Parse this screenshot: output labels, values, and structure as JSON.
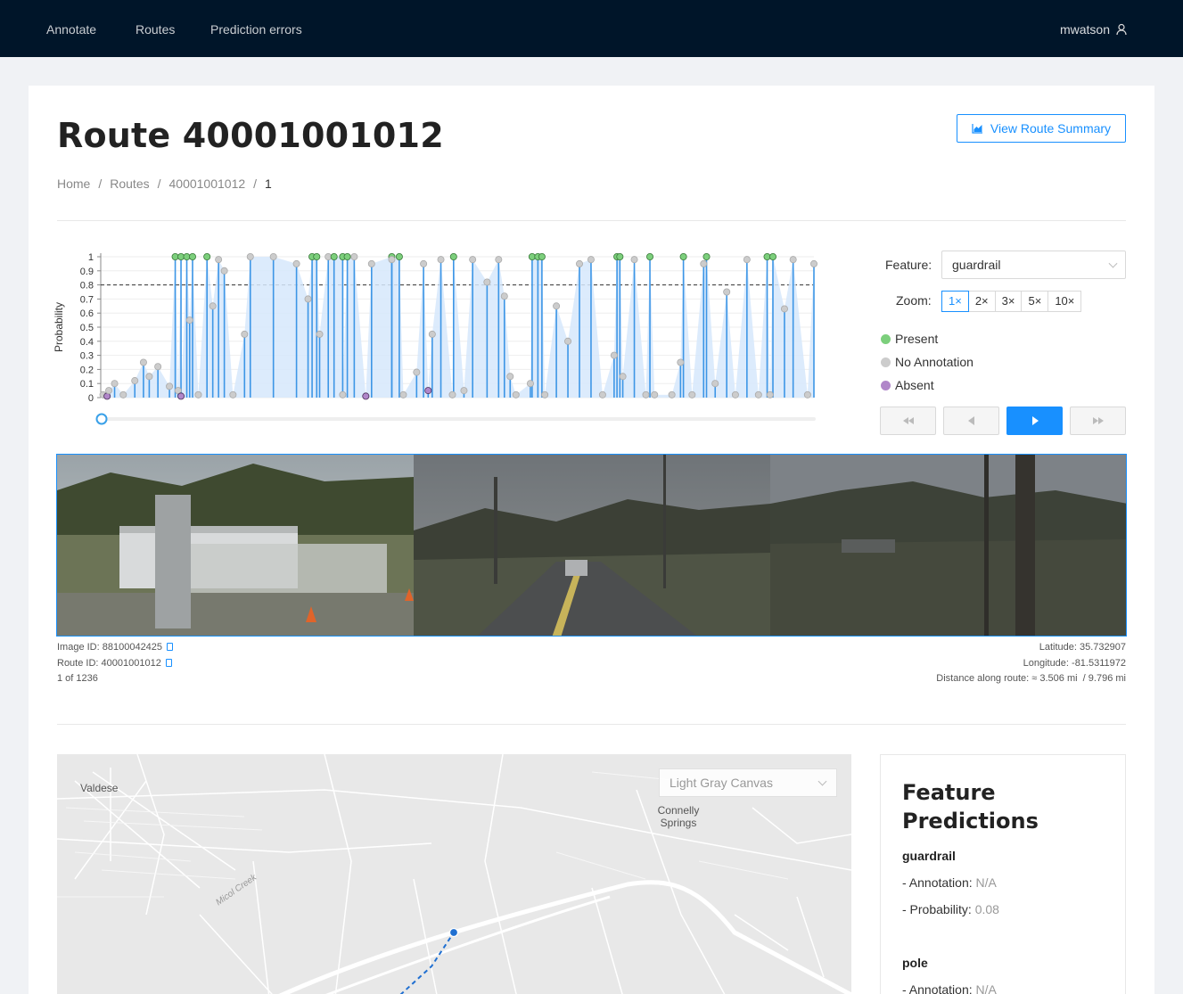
{
  "nav": {
    "items": [
      "Annotate",
      "Routes",
      "Prediction errors"
    ],
    "user": "mwatson"
  },
  "page": {
    "title": "Route 40001001012",
    "summary_button": "View Route Summary",
    "breadcrumb": [
      "Home",
      "Routes",
      "40001001012",
      "1"
    ]
  },
  "chart_data": {
    "type": "scatter",
    "ylabel": "Probability",
    "ylim": [
      0,
      1
    ],
    "yticks": [
      "1",
      "0.9",
      "0.8",
      "0.7",
      "0.6",
      "0.5",
      "0.4",
      "0.3",
      "0.2",
      "0.1",
      "0"
    ],
    "threshold": 0.8,
    "x_range": [
      1,
      1236
    ],
    "series": [
      {
        "name": "Present",
        "color": "#7ccf7c",
        "points": [
          [
            130,
            1
          ],
          [
            140,
            1
          ],
          [
            150,
            1
          ],
          [
            160,
            1
          ],
          [
            185,
            1
          ],
          [
            367,
            1
          ],
          [
            375,
            1
          ],
          [
            405,
            1
          ],
          [
            420,
            1
          ],
          [
            428,
            1
          ],
          [
            505,
            1
          ],
          [
            518,
            1
          ],
          [
            612,
            1
          ],
          [
            748,
            1
          ],
          [
            758,
            1
          ],
          [
            765,
            1
          ],
          [
            895,
            1
          ],
          [
            900,
            1
          ],
          [
            952,
            1
          ],
          [
            1010,
            1
          ],
          [
            1050,
            1
          ],
          [
            1155,
            1
          ],
          [
            1165,
            1
          ]
        ]
      },
      {
        "name": "No Annotation",
        "color": "#cccccc",
        "points": [
          [
            5,
            0.02
          ],
          [
            15,
            0.05
          ],
          [
            25,
            0.1
          ],
          [
            40,
            0.02
          ],
          [
            60,
            0.12
          ],
          [
            75,
            0.25
          ],
          [
            85,
            0.15
          ],
          [
            100,
            0.22
          ],
          [
            120,
            0.08
          ],
          [
            135,
            0.05
          ],
          [
            155,
            0.55
          ],
          [
            170,
            0.02
          ],
          [
            195,
            0.65
          ],
          [
            205,
            0.98
          ],
          [
            215,
            0.9
          ],
          [
            230,
            0.02
          ],
          [
            250,
            0.45
          ],
          [
            260,
            1
          ],
          [
            300,
            1
          ],
          [
            340,
            0.95
          ],
          [
            360,
            0.7
          ],
          [
            380,
            0.45
          ],
          [
            395,
            1
          ],
          [
            420,
            0.02
          ],
          [
            440,
            1
          ],
          [
            470,
            0.95
          ],
          [
            505,
            0.98
          ],
          [
            525,
            0.02
          ],
          [
            548,
            0.18
          ],
          [
            560,
            0.95
          ],
          [
            575,
            0.45
          ],
          [
            590,
            0.98
          ],
          [
            610,
            0.02
          ],
          [
            630,
            0.05
          ],
          [
            645,
            0.98
          ],
          [
            670,
            0.82
          ],
          [
            690,
            0.98
          ],
          [
            700,
            0.72
          ],
          [
            710,
            0.15
          ],
          [
            720,
            0.02
          ],
          [
            745,
            0.1
          ],
          [
            770,
            0.02
          ],
          [
            790,
            0.65
          ],
          [
            810,
            0.4
          ],
          [
            830,
            0.95
          ],
          [
            850,
            0.98
          ],
          [
            870,
            0.02
          ],
          [
            890,
            0.3
          ],
          [
            905,
            0.15
          ],
          [
            925,
            0.98
          ],
          [
            945,
            0.02
          ],
          [
            960,
            0.02
          ],
          [
            990,
            0.02
          ],
          [
            1005,
            0.25
          ],
          [
            1025,
            0.02
          ],
          [
            1045,
            0.95
          ],
          [
            1065,
            0.1
          ],
          [
            1085,
            0.75
          ],
          [
            1100,
            0.02
          ],
          [
            1120,
            0.98
          ],
          [
            1140,
            0.02
          ],
          [
            1160,
            0.02
          ],
          [
            1185,
            0.63
          ],
          [
            1200,
            0.98
          ],
          [
            1225,
            0.02
          ],
          [
            1236,
            0.95
          ]
        ]
      },
      {
        "name": "Absent",
        "color": "#b086c9",
        "points": [
          [
            12,
            0.01
          ],
          [
            140,
            0.01
          ],
          [
            460,
            0.01
          ],
          [
            568,
            0.05
          ]
        ]
      }
    ],
    "legend": [
      "Present",
      "No Annotation",
      "Absent"
    ]
  },
  "controls": {
    "feature_label": "Feature:",
    "feature_value": "guardrail",
    "zoom_label": "Zoom:",
    "zoom_options": [
      "1×",
      "2×",
      "3×",
      "5×",
      "10×"
    ],
    "zoom_active": "1×"
  },
  "image_meta": {
    "image_id": "Image ID: 88100042425",
    "route_id": "Route ID: 40001001012",
    "position": "1 of 1236",
    "latitude": "Latitude: 35.732907",
    "longitude": "Longitude: -81.5311972",
    "distance": "Distance along route: ≈ 3.506 mi  / 9.796 mi"
  },
  "map": {
    "basemap": "Light Gray Canvas",
    "labels": [
      "Valdese",
      "Connelly Springs",
      "Micol Creek"
    ]
  },
  "predictions": {
    "title": "Feature Predictions",
    "features": [
      {
        "name": "guardrail",
        "annotation_label": "- Annotation:",
        "annotation": "N/A",
        "probability_label": "- Probability:",
        "probability": "0.08"
      },
      {
        "name": "pole",
        "annotation_label": "- Annotation:",
        "annotation": "N/A"
      }
    ]
  },
  "colors": {
    "primary": "#1890ff",
    "header": "#001529",
    "present": "#7ccf7c",
    "none": "#cccccc",
    "absent": "#b086c9"
  }
}
